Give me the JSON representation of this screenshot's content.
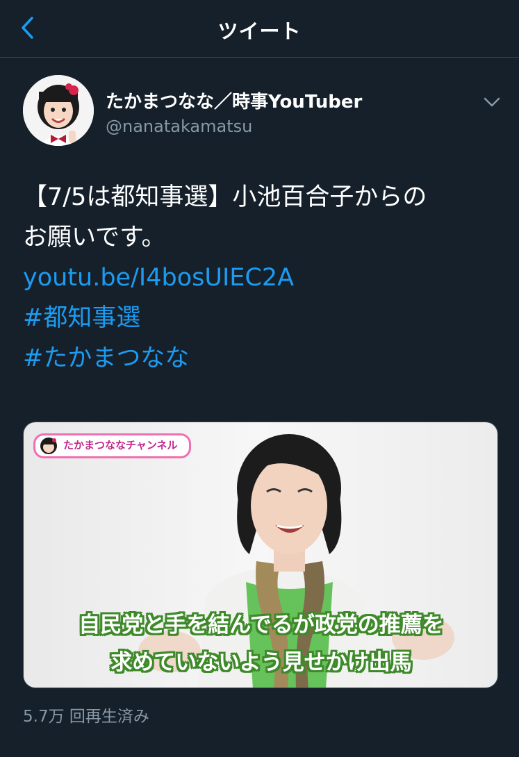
{
  "header": {
    "title": "ツイート",
    "back_icon": "chevron-left-icon"
  },
  "author": {
    "display_name": "たかまつなな／時事YouTuber",
    "handle": "@nanatakamatsu",
    "menu_icon": "chevron-down-icon"
  },
  "tweet": {
    "text_line_1": "【7/5は都知事選】小池百合子からの",
    "text_line_2": "お願いです。",
    "link": "youtu.be/I4bosUIEC2A",
    "hashtags": [
      "#都知事選",
      "#たかまつなな"
    ]
  },
  "media": {
    "channel_badge": "たかまつななチャンネル",
    "caption_line_1": "自民党と手を結んでるが政党の推薦を",
    "caption_line_2": "求めていないよう見せかけ出馬"
  },
  "stats": {
    "views": "5.7万 回再生済み"
  },
  "colors": {
    "background": "#15202b",
    "link": "#1d9bf0",
    "secondary_text": "#8899a6",
    "divider": "#38444d"
  }
}
